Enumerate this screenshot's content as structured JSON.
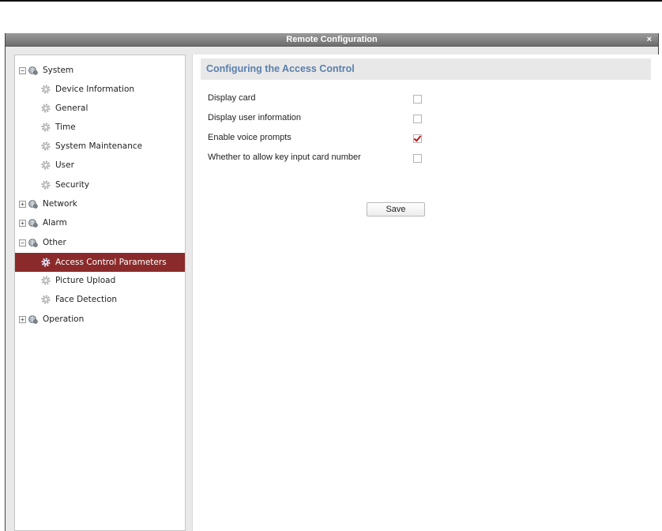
{
  "window": {
    "title": "Remote Configuration",
    "close_glyph": "×"
  },
  "tree": {
    "system": {
      "label": "System",
      "expander": "−"
    },
    "system_children": [
      "Device Information",
      "General",
      "Time",
      "System Maintenance",
      "User",
      "Security"
    ],
    "network": {
      "label": "Network",
      "expander": "+"
    },
    "alarm": {
      "label": "Alarm",
      "expander": "+"
    },
    "other": {
      "label": "Other",
      "expander": "−"
    },
    "other_children": [
      "Access Control Parameters",
      "Picture Upload",
      "Face Detection"
    ],
    "operation": {
      "label": "Operation",
      "expander": "+"
    },
    "selected": "Access Control Parameters"
  },
  "panel": {
    "title": "Configuring the Access Control",
    "options": [
      {
        "label": "Display card",
        "checked": false
      },
      {
        "label": "Display user information",
        "checked": false
      },
      {
        "label": "Enable voice prompts",
        "checked": true
      },
      {
        "label": "Whether to allow key input card number",
        "checked": false
      }
    ],
    "save_label": "Save"
  },
  "colors": {
    "selected_bg": "#8b2a2a",
    "header_text": "#5a7fad",
    "check_mark": "#c0171b"
  },
  "icons": {
    "group": "globe-gear-icon",
    "item": "gear-icon"
  }
}
